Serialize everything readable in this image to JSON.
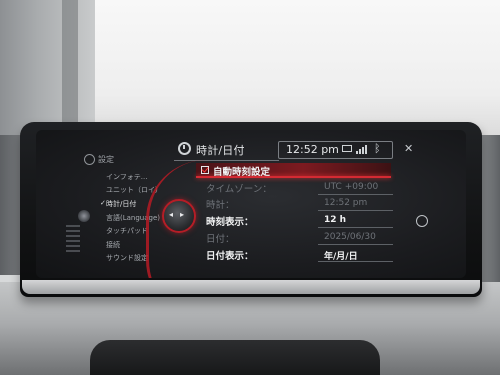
{
  "header": {
    "title": "時計/日付",
    "time": "12:52 pm"
  },
  "side_menu": {
    "heading": "設定",
    "items": [
      {
        "label": "インフォテ..."
      },
      {
        "label": "ユニット（ロイ）"
      },
      {
        "label": "時計/日付",
        "selected": true,
        "check": "✓"
      },
      {
        "label": "言語(Language)"
      },
      {
        "label": "タッチパッド"
      },
      {
        "label": "接続"
      },
      {
        "label": "サウンド設定"
      }
    ]
  },
  "controller": {
    "left_arrow": "◂",
    "right_arrow": "▸"
  },
  "settings": {
    "auto_time": {
      "label": "自動時刻設定",
      "checked": true
    },
    "timezone": {
      "label": "タイムゾーン：",
      "value": "UTC +09:00"
    },
    "clock": {
      "label": "時計：",
      "value": "12:52 pm"
    },
    "time_format": {
      "label": "時刻表示：",
      "value": "12 h"
    },
    "date": {
      "label": "日付：",
      "value": "2025/06/30"
    },
    "date_format": {
      "label": "日付表示：",
      "value": "年/月/日"
    }
  },
  "colors": {
    "accent_red": "#c01b25",
    "status_led": "#8cff5e"
  },
  "icons": {
    "mute": "✕",
    "bluetooth": "ᛒ"
  }
}
